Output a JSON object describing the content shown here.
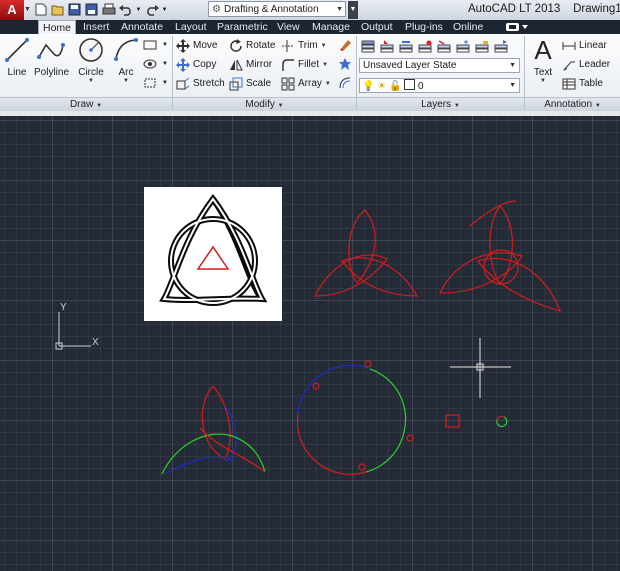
{
  "app": {
    "menu_letter": "A",
    "title": "AutoCAD LT 2013",
    "drawing_name": "Drawing1"
  },
  "quick_access": {
    "workspace": "Drafting & Annotation",
    "icons": [
      "new-icon",
      "open-icon",
      "save-icon",
      "save-as-icon",
      "print-icon",
      "undo-icon",
      "redo-icon"
    ]
  },
  "tabs": [
    "Home",
    "Insert",
    "Annotate",
    "Layout",
    "Parametric",
    "View",
    "Manage",
    "Output",
    "Plug-ins",
    "Online"
  ],
  "active_tab": "Home",
  "panels": {
    "draw": {
      "title": "Draw",
      "tools": [
        "Line",
        "Polyline",
        "Circle",
        "Arc"
      ]
    },
    "modify": {
      "title": "Modify",
      "tools": [
        "Move",
        "Rotate",
        "Trim",
        "Copy",
        "Mirror",
        "Fillet",
        "Stretch",
        "Scale",
        "Array"
      ]
    },
    "layers": {
      "title": "Layers",
      "layer_state": "Unsaved Layer State",
      "current_layer": "0"
    },
    "annotation": {
      "title": "Annotation",
      "text_label": "Text",
      "tools": [
        "Linear",
        "Leader",
        "Table"
      ]
    }
  },
  "canvas": {
    "ucs_x_label": "X",
    "ucs_y_label": "Y",
    "colors": {
      "background": "#252b36",
      "red": "#d41c1c",
      "green": "#2fcf2f",
      "blue": "#1b2cc8",
      "crosshair": "#e6e6e6"
    }
  }
}
